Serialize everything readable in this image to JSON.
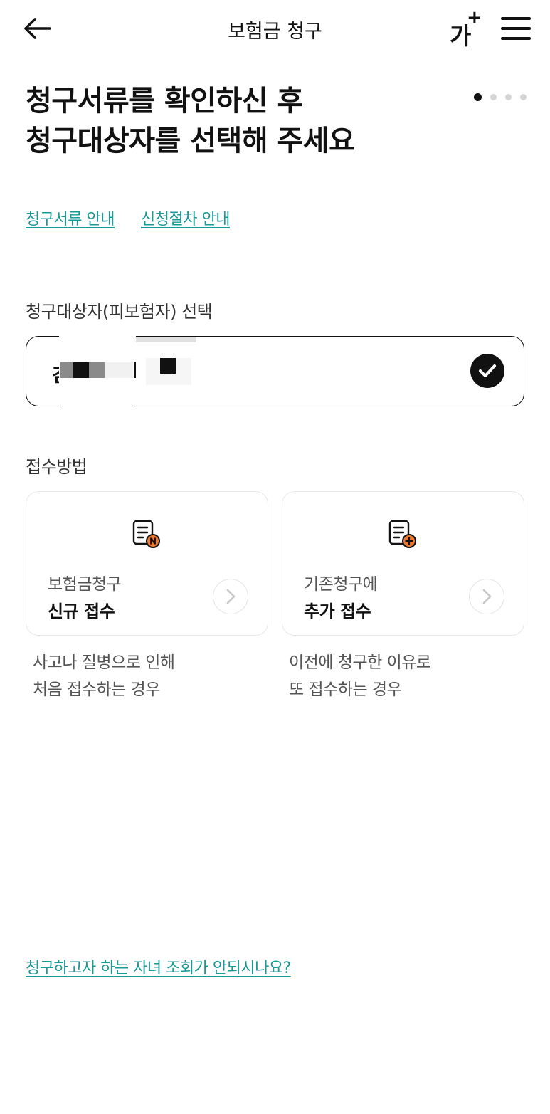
{
  "header": {
    "title": "보험금 청구",
    "font_size_label": "가",
    "font_size_plus": "+",
    "icons": {
      "back": "arrow-left-icon",
      "font_size": "font-size-icon",
      "menu": "hamburger-menu-icon"
    }
  },
  "title": {
    "line1": "청구서류를 확인하신 후",
    "line2": "청구대상자를 선택해 주세요"
  },
  "steps": {
    "total": 4,
    "current": 1
  },
  "links": {
    "documents_guide": "청구서류 안내",
    "procedure_guide": "신청절차 안내"
  },
  "insured_section": {
    "label": "청구대상자(피보험자) 선택",
    "selected_name_visible": "김",
    "selected": true,
    "check_icon": "check-circle-icon"
  },
  "method_section": {
    "label": "접수방법",
    "options": [
      {
        "subtitle": "보험금청구",
        "title": "신규 접수",
        "icon": "document-new-icon",
        "desc_line1": "사고나 질병으로 인해",
        "desc_line2": "처음 접수하는 경우"
      },
      {
        "subtitle": "기존청구에",
        "title": "추가 접수",
        "icon": "document-add-icon",
        "desc_line1": "이전에 청구한 이유로",
        "desc_line2": "또 접수하는 경우"
      }
    ]
  },
  "bottom_link": "청구하고자 하는 자녀 조회가 안되시나요?",
  "colors": {
    "accent": "#1a9a94",
    "icon_badge": "#ee7a32",
    "text_primary": "#111111",
    "text_secondary": "#555555",
    "card_border": "#e8e8e8"
  }
}
